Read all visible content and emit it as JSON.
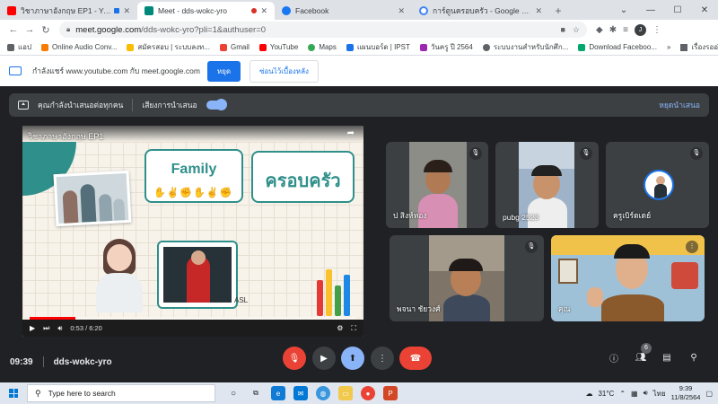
{
  "browser": {
    "tabs": [
      {
        "label": "วิชาภาษาอังกฤษ EP1 - YouTube",
        "favicon_color": "#ff0000",
        "active": false,
        "recording": true
      },
      {
        "label": "Meet - dds-wokc-yro",
        "favicon_color": "#00897b",
        "active": true,
        "recording": true
      },
      {
        "label": "Facebook",
        "favicon_color": "#1877f2",
        "active": false,
        "recording": false
      },
      {
        "label": "การ์ตูนครอบครัว - Google Search",
        "favicon_color": "#4285f4",
        "active": false,
        "recording": false
      }
    ],
    "new_tab_glyph": "+",
    "url_host": "meet.google.com",
    "url_path": "/dds-wokc-yro?pli=1&authuser=0",
    "profile_initial": "J"
  },
  "bookmarks": {
    "items": [
      {
        "label": "แอป",
        "color": "#5f6368"
      },
      {
        "label": "Online Audio Conv...",
        "color": "#f57c00"
      },
      {
        "label": "สมัครสอบ | ระบบลงท...",
        "color": "#fbbc04"
      },
      {
        "label": "Gmail",
        "color": "#ea4335"
      },
      {
        "label": "YouTube",
        "color": "#ff0000"
      },
      {
        "label": "Maps",
        "color": "#34a853"
      },
      {
        "label": "แผนบอร์ด | IPST",
        "color": "#1a73e8"
      },
      {
        "label": "วันครู ปี 2564",
        "color": "#9c27b0"
      },
      {
        "label": "ระบบงานสำหรับนักศึก...",
        "color": "#5f6368"
      },
      {
        "label": "Download Faceboo...",
        "color": "#00a86b"
      }
    ],
    "more": "»",
    "reading_list": "เรื่องรออ่าน"
  },
  "sharebar": {
    "message": "กำลังแชร์ www.youtube.com กับ meet.google.com",
    "stop_label": "หยุด",
    "hide_label": "ซ่อนไว้เบื้องหลัง"
  },
  "presenting": {
    "message": "คุณกำลังนำเสนอต่อทุกคน",
    "audio_label": "เสียงการนำเสนอ",
    "stop_label": "หยุดนำเสนอ"
  },
  "video": {
    "title": "วิชาภาษาอังกฤษ EP1",
    "family_word": "Family",
    "thai_word": "ครอบครัว",
    "sign_text": "ASL",
    "time_display": "0:53 / 6:20",
    "progress": 0.14
  },
  "participants": [
    {
      "name": "ป สิงห์ทอง",
      "muted": true
    },
    {
      "name": "pubg 2523",
      "muted": true
    },
    {
      "name": "ครูเบิร์ดเดย์",
      "muted": true
    },
    {
      "name": "พจนา ชัยวงศ์",
      "muted": true
    },
    {
      "name": "คุณ",
      "muted": false
    }
  ],
  "meeting": {
    "time": "09:39",
    "code": "dds-wokc-yro",
    "people_count": "6"
  },
  "taskbar": {
    "search_placeholder": "Type here to search",
    "temperature": "31°C",
    "language": "ไทย",
    "clock_time": "9:39",
    "clock_date": "11/8/2564"
  }
}
